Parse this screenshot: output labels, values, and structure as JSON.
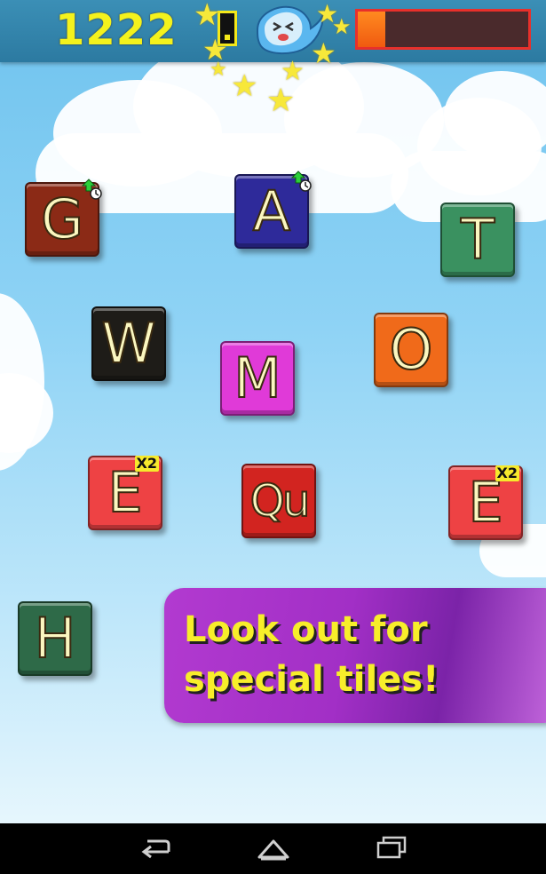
{
  "hud": {
    "score": "1222",
    "time_remaining_fraction": 0.16,
    "mascot_icon": "ghost-mascot-icon"
  },
  "tiles": [
    {
      "letter": "G",
      "color": "#8b2a16",
      "special": "time-bonus"
    },
    {
      "letter": "A",
      "color": "#2e2a9a",
      "special": "time-bonus"
    },
    {
      "letter": "T",
      "color": "#3a9160",
      "special": ""
    },
    {
      "letter": "W",
      "color": "#1e1c18",
      "special": ""
    },
    {
      "letter": "M",
      "color": "#e03ad8",
      "special": ""
    },
    {
      "letter": "O",
      "color": "#f06a1a",
      "special": ""
    },
    {
      "letter": "E",
      "color": "#ee4244",
      "special": "X2"
    },
    {
      "letter": "Qu",
      "color": "#d22420",
      "special": ""
    },
    {
      "letter": "E",
      "color": "#ee4244",
      "special": "X2"
    },
    {
      "letter": "H",
      "color": "#2e6a48",
      "special": ""
    }
  ],
  "banner": {
    "line1": "Look out for",
    "line2": "special tiles!"
  },
  "navbar": {
    "back_icon": "back-icon",
    "home_icon": "home-icon",
    "recents_icon": "recents-icon"
  }
}
